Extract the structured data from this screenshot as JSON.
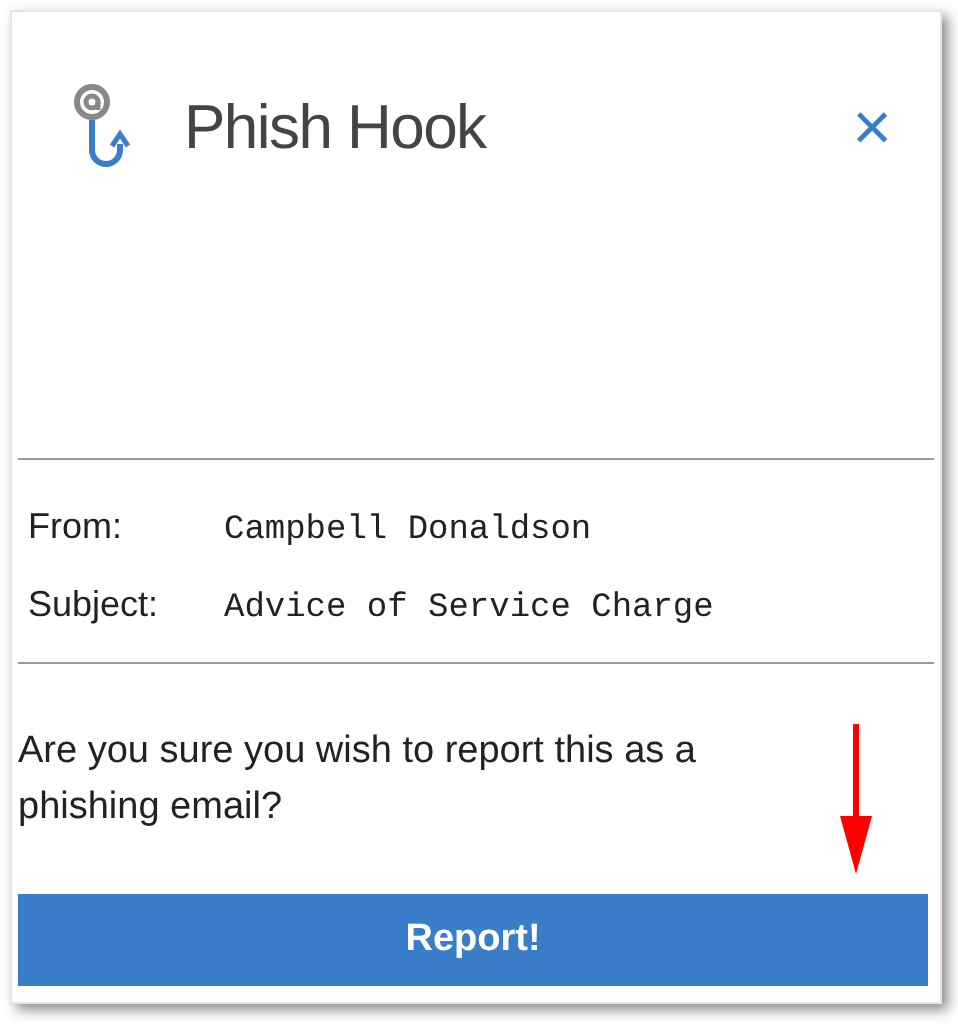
{
  "header": {
    "title": "Phish Hook",
    "close": "×"
  },
  "fields": [
    {
      "label": "From:",
      "value": "Campbell Donaldson"
    },
    {
      "label": "Subject:",
      "value": "Advice of Service Charge"
    }
  ],
  "question": "Are you sure you wish to report this as a phishing email?",
  "button": "Report!"
}
